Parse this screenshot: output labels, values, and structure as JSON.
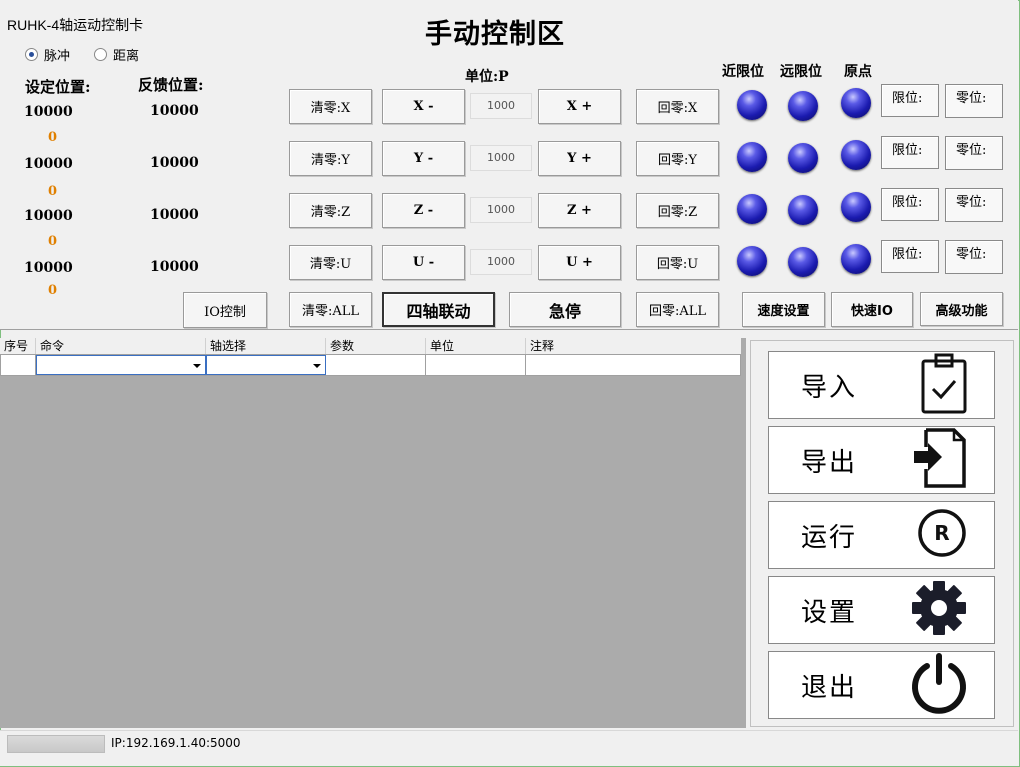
{
  "app": {
    "title": "RUHK-4轴运动控制卡",
    "section_title": "手动控制区"
  },
  "mode": {
    "options": [
      {
        "label": "脉冲",
        "selected": true
      },
      {
        "label": "距离",
        "selected": false
      }
    ]
  },
  "positions": {
    "set_header": "设定位置:",
    "feedback_header": "反馈位置:",
    "rows": [
      {
        "set": "10000",
        "zero": "0",
        "feedback": "10000"
      },
      {
        "set": "10000",
        "zero": "0",
        "feedback": "10000"
      },
      {
        "set": "10000",
        "zero": "0",
        "feedback": "10000"
      },
      {
        "set": "10000",
        "zero": "0",
        "feedback": "10000"
      }
    ]
  },
  "unit_label": "单位:P",
  "limit_headers": {
    "near": "近限位",
    "far": "远限位",
    "origin": "原点"
  },
  "axes": [
    {
      "clear": "清零:X",
      "minus": "X -",
      "step": "1000",
      "plus": "X +",
      "home": "回零:X",
      "limit_box": "限位:",
      "zero_box": "零位:"
    },
    {
      "clear": "清零:Y",
      "minus": "Y -",
      "step": "1000",
      "plus": "Y +",
      "home": "回零:Y",
      "limit_box": "限位:",
      "zero_box": "零位:"
    },
    {
      "clear": "清零:Z",
      "minus": "Z -",
      "step": "1000",
      "plus": "Z +",
      "home": "回零:Z",
      "limit_box": "限位:",
      "zero_box": "零位:"
    },
    {
      "clear": "清零:U",
      "minus": "U -",
      "step": "1000",
      "plus": "U +",
      "home": "回零:U",
      "limit_box": "限位:",
      "zero_box": "零位:"
    }
  ],
  "bottom_buttons": {
    "io_control": "IO控制",
    "clear_all": "清零:ALL",
    "four_axis": "四轴联动",
    "estop": "急停",
    "home_all": "回零:ALL",
    "speed_settings": "速度设置",
    "quick_io": "快速IO",
    "advanced": "高级功能"
  },
  "grid": {
    "columns": [
      "序号",
      "命令",
      "轴选择",
      "参数",
      "单位",
      "注释"
    ]
  },
  "side_buttons": [
    {
      "label": "导入",
      "icon": "clipboard-check-icon"
    },
    {
      "label": "导出",
      "icon": "export-icon"
    },
    {
      "label": "运行",
      "icon": "run-r-icon"
    },
    {
      "label": "设置",
      "icon": "gear-icon"
    },
    {
      "label": "退出",
      "icon": "power-icon"
    }
  ],
  "status": {
    "ip": "IP:192.169.1.40:5000"
  },
  "colors": {
    "led": "#1b1bb0",
    "zero_text": "#e08000"
  }
}
